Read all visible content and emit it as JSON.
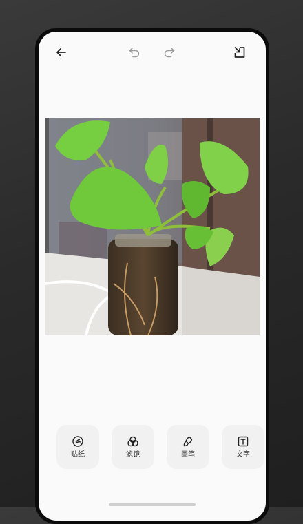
{
  "toolbar": {
    "back_icon": "arrow-left-icon",
    "undo_icon": "undo-icon",
    "redo_icon": "redo-icon",
    "export_icon": "export-icon"
  },
  "image": {
    "subject": "pothos-plant-in-glass-jar"
  },
  "tools": [
    {
      "label": "贴纸",
      "icon": "sticker-icon"
    },
    {
      "label": "滤镜",
      "icon": "filter-icon"
    },
    {
      "label": "画笔",
      "icon": "brush-icon"
    },
    {
      "label": "文字",
      "icon": "text-icon"
    }
  ],
  "colors": {
    "screen_bg": "#fafafa",
    "tool_bg": "#f1f1f1",
    "icon": "#222222",
    "disabled_icon": "#9a9a9a",
    "leaf": "#6fc93a"
  }
}
